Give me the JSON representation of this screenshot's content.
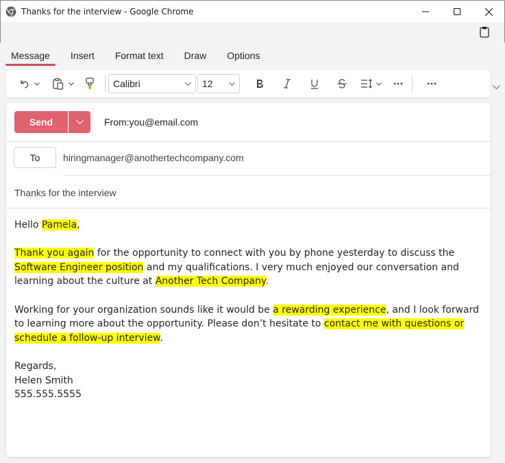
{
  "window": {
    "title": "Thanks for the interview - Google Chrome"
  },
  "ribbon": {
    "tabs": [
      {
        "label": "Message",
        "active": true
      },
      {
        "label": "Insert",
        "active": false
      },
      {
        "label": "Format text",
        "active": false
      },
      {
        "label": "Draw",
        "active": false
      },
      {
        "label": "Options",
        "active": false
      }
    ],
    "font_name": "Calibri",
    "font_size": "12"
  },
  "compose": {
    "send_label": "Send",
    "from_label": "From:",
    "from_value": "you@email.com",
    "to_label": "To",
    "to_value": "hiringmanager@anothertechcompany.com",
    "subject": "Thanks for the interview",
    "highlight_color": "#ffff00",
    "accent_color": "#e0626f"
  },
  "body": {
    "greeting_prefix": "Hello ",
    "greeting_name": "Pamela",
    "greeting_suffix": ",",
    "p1_hl1": "Thank you again",
    "p1_t1": " for the opportunity to connect with you by phone yesterday to discuss the ",
    "p1_hl2": "Software Engineer position",
    "p1_t2": " and my qualifications. I very much enjoyed our conversation and learning about the culture at ",
    "p1_hl3": "Another Tech Company",
    "p1_t3": ".",
    "p2_t1": "Working for your organization sounds like it would be ",
    "p2_hl1": "a rewarding experience",
    "p2_t2": ", and I look forward to learning more about the opportunity. Please don’t hesitate to ",
    "p2_hl2": "contact me with questions or schedule a follow-up interview",
    "p2_t3": ".",
    "closing": "Regards,",
    "signature_name": "Helen Smith",
    "signature_phone": "555.555.5555"
  }
}
